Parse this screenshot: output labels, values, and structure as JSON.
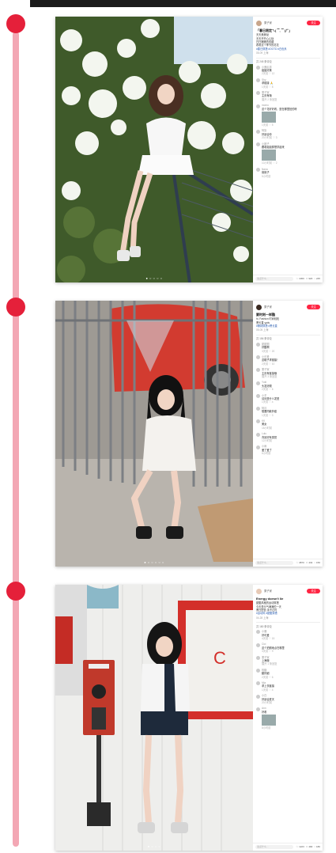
{
  "posts": [
    {
      "author": "栗子家",
      "follow_label": "关注",
      "title": "「春日限定ㄟ( ▔, ▔ )ㄏ」",
      "body": "天天美美哒\n天天开开心心哒\n白白嫩嫩的双腿\n看看这个季节的花花",
      "tags": "#春日穿搭 #OOTD #白色系",
      "date": "05-09 上海",
      "comment_count": "共 245 条评论",
      "comments": [
        {
          "name": "小鹿乱撞",
          "text": "姐姐好美",
          "meta": "2天前  ♡ 12"
        },
        {
          "name": "Shy",
          "text": "求链接 🙏",
          "meta": "1天前  ♡ 8"
        },
        {
          "name": "栗子家",
          "text": "主页有哦",
          "meta": "展开 2 条回复"
        },
        {
          "name": "momo",
          "text": "这个花好好看，是在哪里拍的呀",
          "meta": "1天前  ♡ 5"
        },
        {
          "name": "阿柒",
          "text": "好适合你",
          "meta": "20小时前  ♡ 3"
        },
        {
          "name": "小团子",
          "text": "跟着姐姐穿搭学起来",
          "meta": "10小时前  ♡ 2"
        },
        {
          "name": "Nana",
          "text": "绝绝子",
          "meta": "5小时前"
        }
      ],
      "say_placeholder": "说点什么...",
      "likes": "1060",
      "stars": "920",
      "comments_stat": "245"
    },
    {
      "author": "栗子家",
      "follow_label": "关注",
      "title": "要时刻一样酷",
      "body": "hi, Fashion 时尚轻松\n黑长直 yyds",
      "tags": "#辣妹穿搭 #黑长直",
      "date": "05-05 上海",
      "comment_count": "共 156 条评论",
      "comments": [
        {
          "name": "甜甜圈",
          "text": "好酷啊",
          "meta": "3天前  ♡ 20"
        },
        {
          "name": "小可爱",
          "text": "这鞋子求链接！",
          "meta": "2天前  ♡ 10"
        },
        {
          "name": "栗子家",
          "text": "主页有链接哦",
          "meta": "展开 3 条回复"
        },
        {
          "name": "Yuki",
          "text": "头发好顺",
          "meta": "2天前  ♡ 6"
        },
        {
          "name": "小羊",
          "text": "请问是什么发型",
          "meta": "1天前  ♡ 4"
        },
        {
          "name": "阿月",
          "text": "想要同款外套",
          "meta": "1天前  ♡ 3"
        },
        {
          "name": "KK",
          "text": "美女",
          "meta": "18小时前"
        },
        {
          "name": "Lulu",
          "text": "背景好有感觉",
          "meta": "12小时前"
        },
        {
          "name": "小雨",
          "text": "爱了爱了",
          "meta": "6小时前"
        }
      ],
      "say_placeholder": "说点什么...",
      "likes": "3870",
      "stars": "432",
      "comments_stat": "156"
    },
    {
      "author": "栗子家",
      "follow_label": "关注",
      "title": "Energy doesn't lie",
      "body": "甜酷风格的运动穿搭\n今天是元气满满的一天\n黑白配色 永不过时",
      "tags": "#运动风 #甜酷穿搭",
      "date": "04-28 上海",
      "comment_count": "共 180 条评论",
      "comments": [
        {
          "name": "小鹿",
          "text": "好可爱",
          "meta": "4天前  ♡ 15"
        },
        {
          "name": "Cici",
          "text": "这个拍照地点在哪里",
          "meta": "3天前  ♡ 9"
        },
        {
          "name": "栗子家",
          "text": "上海哦",
          "meta": "展开 1 条回复"
        },
        {
          "name": "软糖",
          "text": "腿好细",
          "meta": "2天前  ♡ 6"
        },
        {
          "name": "Mia",
          "text": "求上衣链接",
          "meta": "1天前  ♡ 4"
        },
        {
          "name": "小白",
          "text": "好适合夏天",
          "meta": "20小时前"
        },
        {
          "name": "Ann",
          "text": "好看",
          "meta": "8小时前"
        }
      ],
      "say_placeholder": "说点什么...",
      "likes": "1223",
      "stars": "490",
      "comments_stat": "180"
    }
  ],
  "colors": {
    "brand_red": "#ff2442",
    "timeline_dot": "#e5203a",
    "timeline_rail": "#f3a7b4"
  },
  "icons": [
    "heart-icon",
    "star-icon",
    "comment-icon"
  ]
}
